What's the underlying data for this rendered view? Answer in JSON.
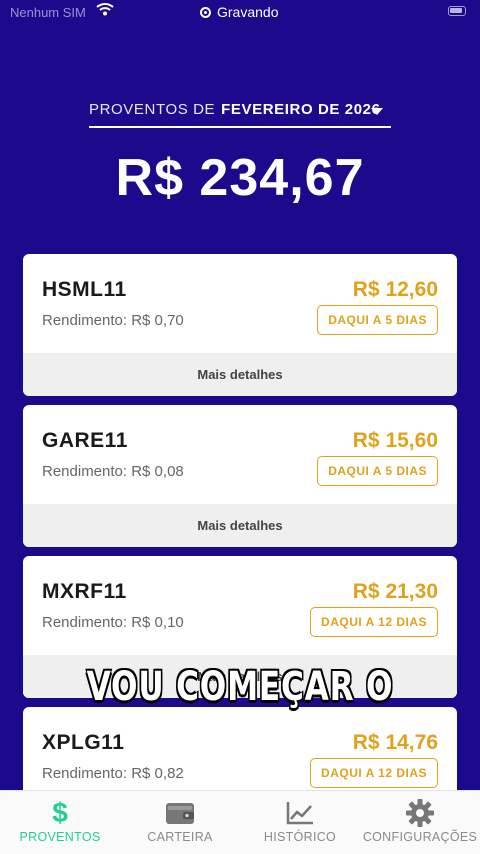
{
  "status_bar": {
    "carrier": "Nenhum SIM",
    "recording_label": "Gravando"
  },
  "header": {
    "month_prefix": "PROVENTOS DE",
    "month_value": "FEVEREIRO DE 2026",
    "total": "R$ 234,67"
  },
  "cards": [
    {
      "ticker": "HSML11",
      "yield": "Rendimento: R$ 0,70",
      "amount": "R$ 12,60",
      "due": "DAQUI A 5 DIAS",
      "details": "Mais detalhes"
    },
    {
      "ticker": "GARE11",
      "yield": "Rendimento: R$ 0,08",
      "amount": "R$ 15,60",
      "due": "DAQUI A 5 DIAS",
      "details": "Mais detalhes"
    },
    {
      "ticker": "MXRF11",
      "yield": "Rendimento: R$ 0,10",
      "amount": "R$ 21,30",
      "due": "DAQUI A 12 DIAS",
      "details": "Mais detalhes"
    },
    {
      "ticker": "XPLG11",
      "yield": "Rendimento: R$ 0,82",
      "amount": "R$ 14,76",
      "due": "DAQUI A 12 DIAS"
    }
  ],
  "subtitle": "VOU COMEÇAR O",
  "tabbar": {
    "active_color": "#1fd190",
    "tabs": [
      {
        "label": "PROVENTOS",
        "icon": "dollar-icon"
      },
      {
        "label": "CARTEIRA",
        "icon": "wallet-icon"
      },
      {
        "label": "HISTÓRICO",
        "icon": "chart-line-icon"
      },
      {
        "label": "CONFIGURAÇÕES",
        "icon": "gear-icon"
      }
    ]
  },
  "colors": {
    "background": "#1c0a8c",
    "accent_gold": "#e0a21b"
  }
}
